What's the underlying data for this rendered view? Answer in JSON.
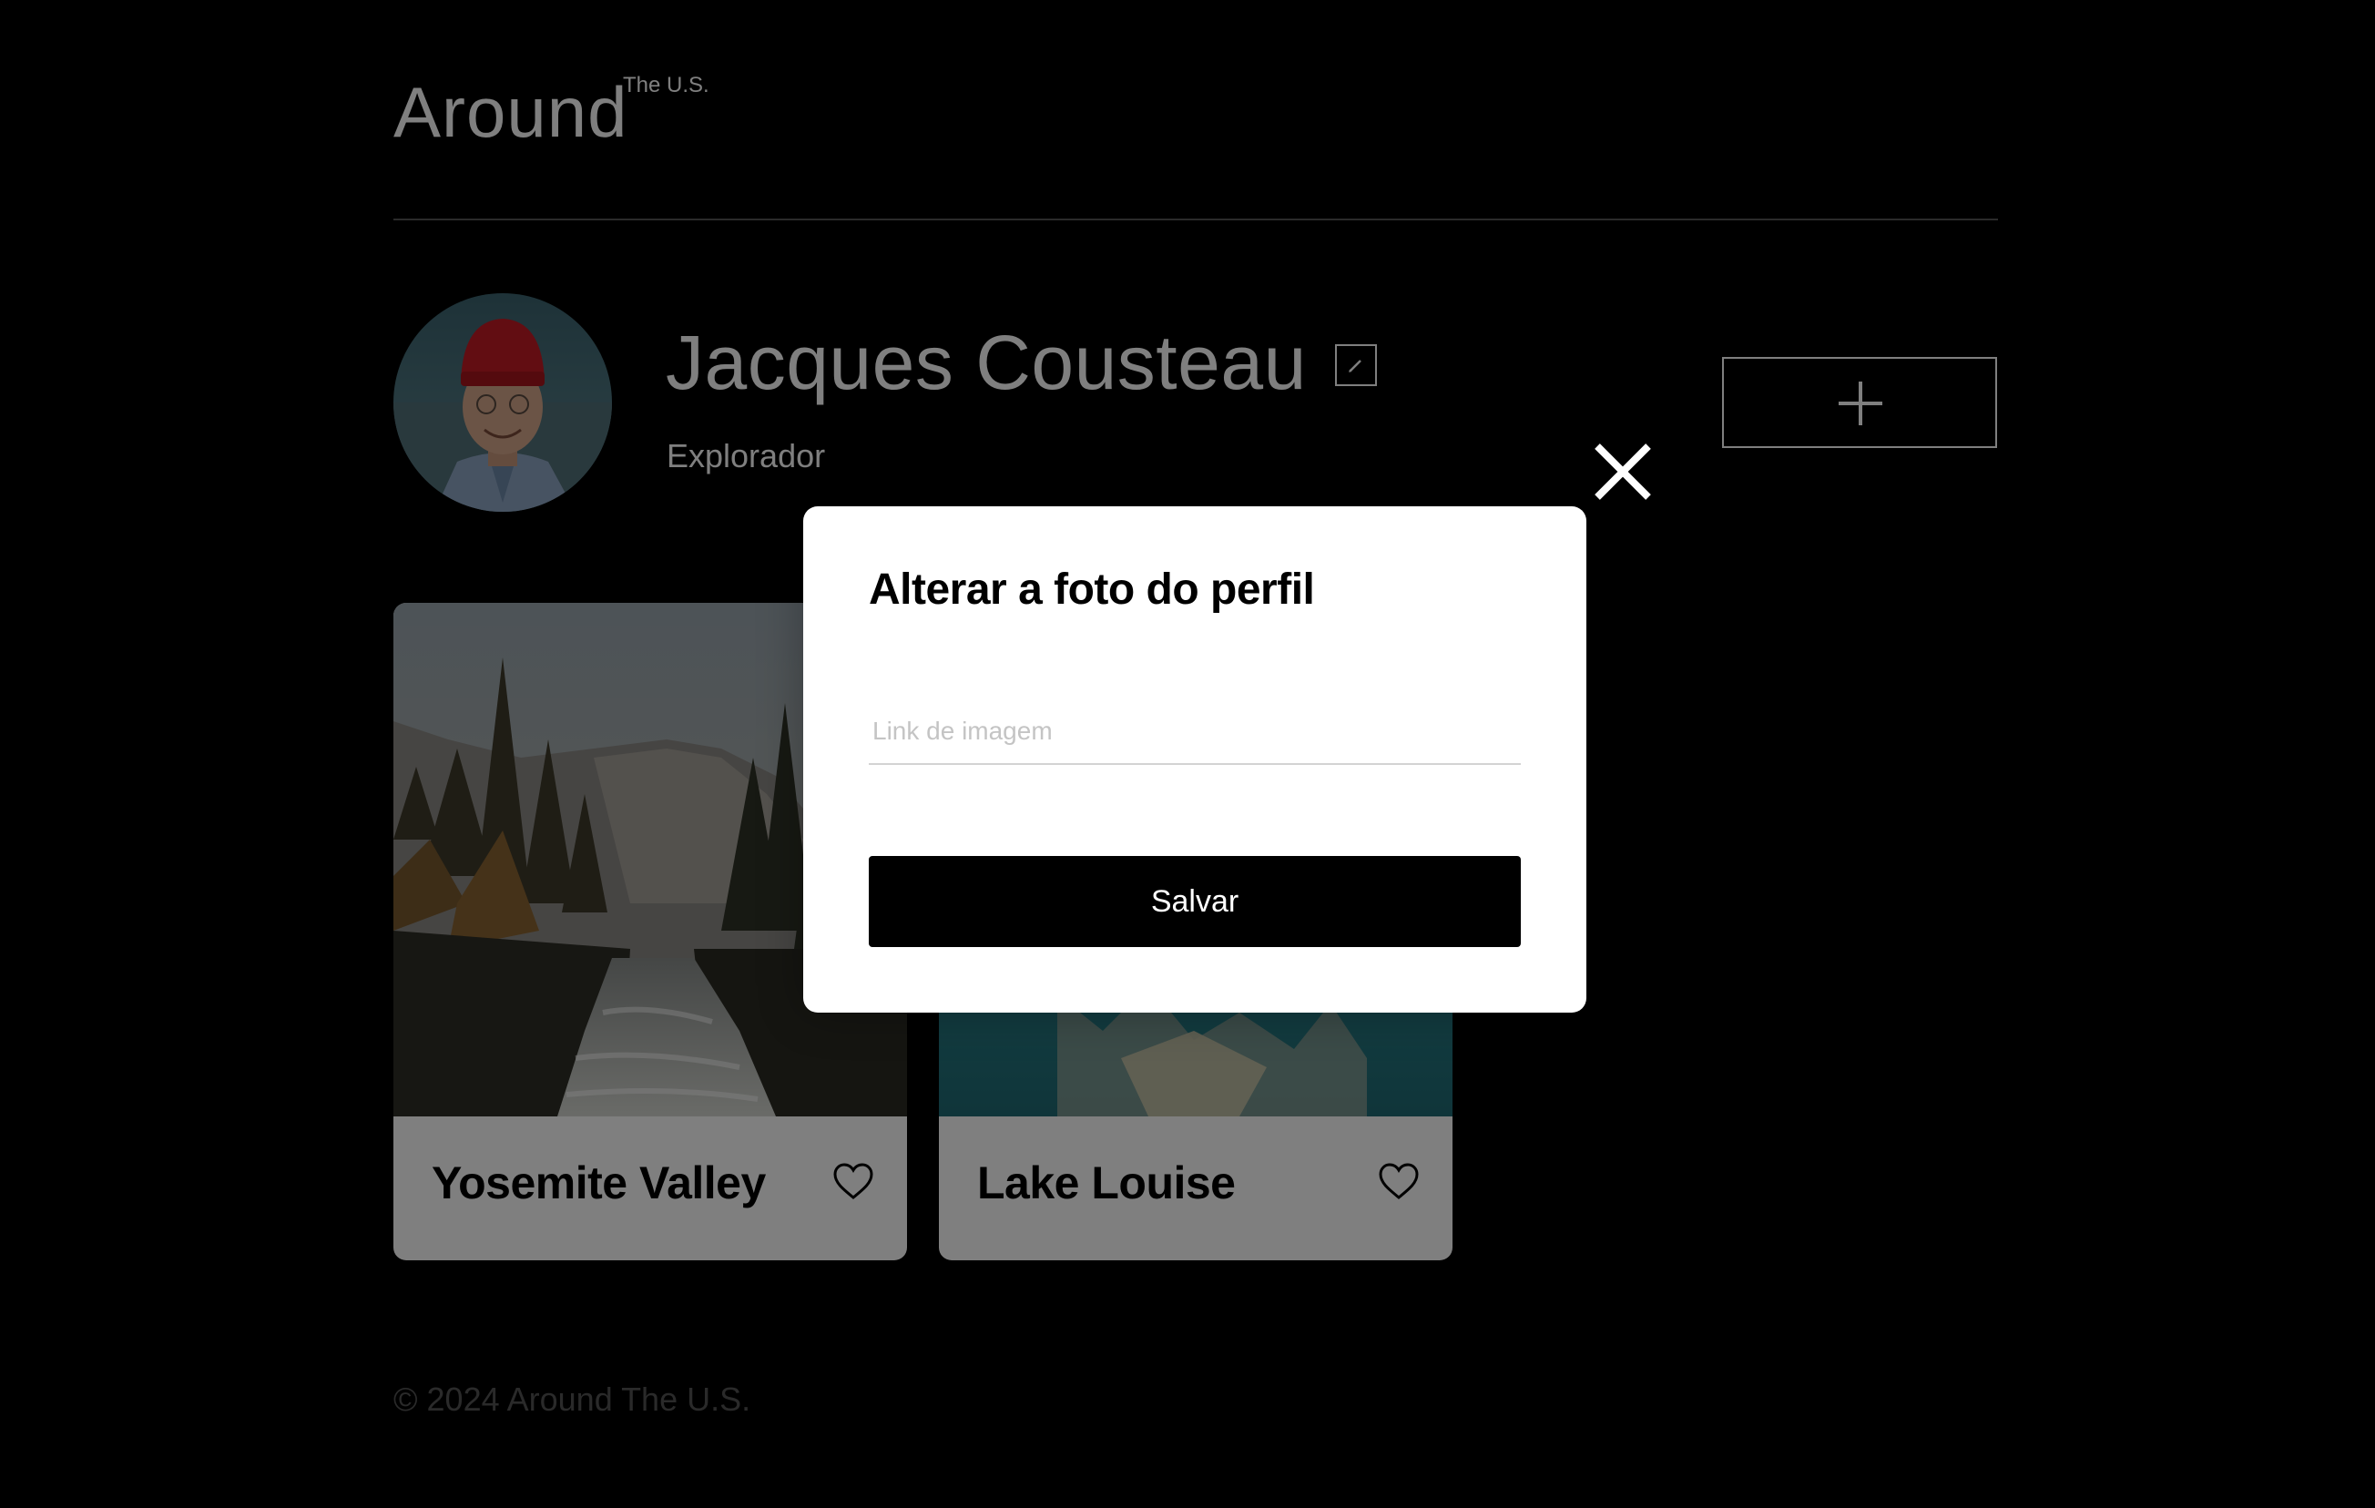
{
  "header": {
    "logo_main": "Around",
    "logo_sup": "The U.S."
  },
  "profile": {
    "name": "Jacques Cousteau",
    "about": "Explorador",
    "avatar_alt": "Jacques Cousteau avatar"
  },
  "cards": [
    {
      "title": "Yosemite Valley",
      "image": "forest-river-valley"
    },
    {
      "title": "Lake Louise",
      "image": "mountain-lake"
    }
  ],
  "footer": {
    "text": "© 2024 Around The U.S."
  },
  "popup": {
    "title": "Alterar a foto do perfil",
    "input_placeholder": "Link de imagem",
    "input_value": "",
    "save_label": "Salvar"
  },
  "icons": {
    "edit": "pencil-icon",
    "add": "plus-icon",
    "like": "heart-icon",
    "close": "close-icon"
  },
  "colors": {
    "background": "#000000",
    "card_background": "#ffffff",
    "footer_text": "#545454",
    "divider": "#545454",
    "input_border": "#d3d3d3"
  }
}
